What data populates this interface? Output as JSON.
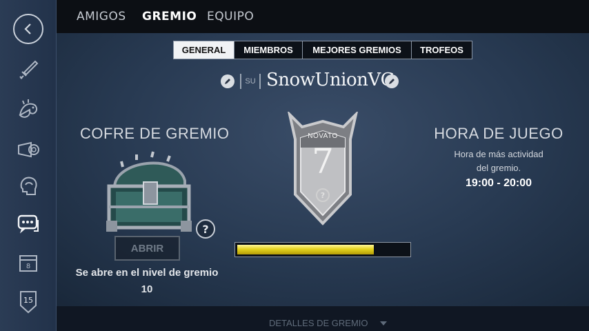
{
  "top_tabs": [
    {
      "label": "AMIGOS",
      "active": false
    },
    {
      "label": "GREMIO",
      "active": true
    },
    {
      "label": "EQUIPO",
      "active": false
    }
  ],
  "sub_tabs": [
    {
      "label": "GENERAL",
      "active": true
    },
    {
      "label": "MIEMBROS",
      "active": false
    },
    {
      "label": "MEJORES GREMIOS",
      "active": false
    },
    {
      "label": "TROFEOS",
      "active": false
    }
  ],
  "sidebar": {
    "items": [
      {
        "icon": "back-arrow-icon"
      },
      {
        "icon": "sword-icon"
      },
      {
        "icon": "dragon-icon"
      },
      {
        "icon": "horn-icon"
      },
      {
        "icon": "head-profile-icon"
      },
      {
        "icon": "chat-bubbles-icon",
        "active": true
      },
      {
        "icon": "calendar-chest-icon",
        "badge": "8"
      },
      {
        "icon": "level-shield-icon",
        "badge": "15"
      }
    ]
  },
  "guild": {
    "tag": "SU",
    "name": "SnowUnionVG"
  },
  "chest": {
    "title": "COFRE DE GREMIO",
    "open_label": "ABRIR",
    "note": "Se abre en el nivel de gremio",
    "unlock_level": "10",
    "help": "?"
  },
  "rank": {
    "label": "NOVATO",
    "level": "7",
    "help": "?",
    "progress": 0.8
  },
  "play_hours": {
    "title": "HORA DE JUEGO",
    "description_line1": "Hora de más actividad",
    "description_line2": "del gremio.",
    "range": "19:00 - 20:00"
  },
  "footer": {
    "details_label": "DETALLES DE GREMIO"
  },
  "colors": {
    "accent_gold": "#e4d21e",
    "active_tab_bg": "#f1f3f5"
  }
}
